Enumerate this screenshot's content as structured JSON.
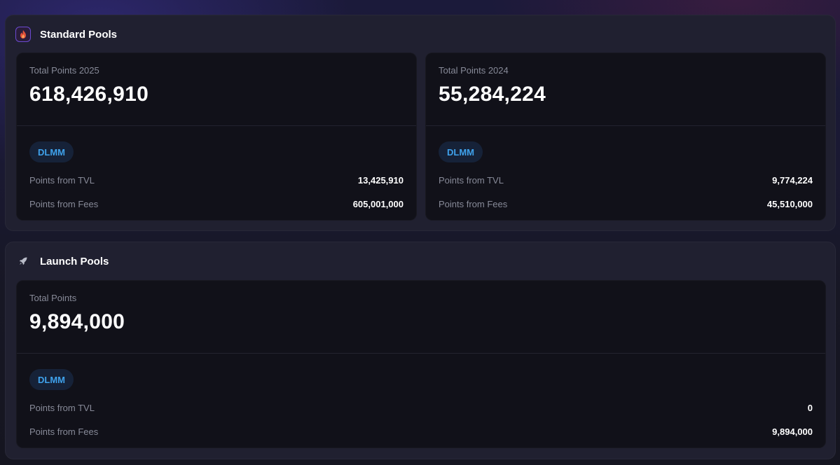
{
  "colors": {
    "badge_text": "#3fa2ec",
    "badge_bg": "#162238",
    "card_bg": "#111119",
    "section_bg": "#202030"
  },
  "standard": {
    "title": "Standard Pools",
    "icon": "flame-icon",
    "cards": [
      {
        "label": "Total Points 2025",
        "total": "618,426,910",
        "badge": "DLMM",
        "tvl_label": "Points from TVL",
        "tvl_value": "13,425,910",
        "fees_label": "Points from Fees",
        "fees_value": "605,001,000"
      },
      {
        "label": "Total Points 2024",
        "total": "55,284,224",
        "badge": "DLMM",
        "tvl_label": "Points from TVL",
        "tvl_value": "9,774,224",
        "fees_label": "Points from Fees",
        "fees_value": "45,510,000"
      }
    ]
  },
  "launch": {
    "title": "Launch Pools",
    "icon": "rocket-icon",
    "card": {
      "label": "Total Points",
      "total": "9,894,000",
      "badge": "DLMM",
      "tvl_label": "Points from TVL",
      "tvl_value": "0",
      "fees_label": "Points from Fees",
      "fees_value": "9,894,000"
    }
  }
}
